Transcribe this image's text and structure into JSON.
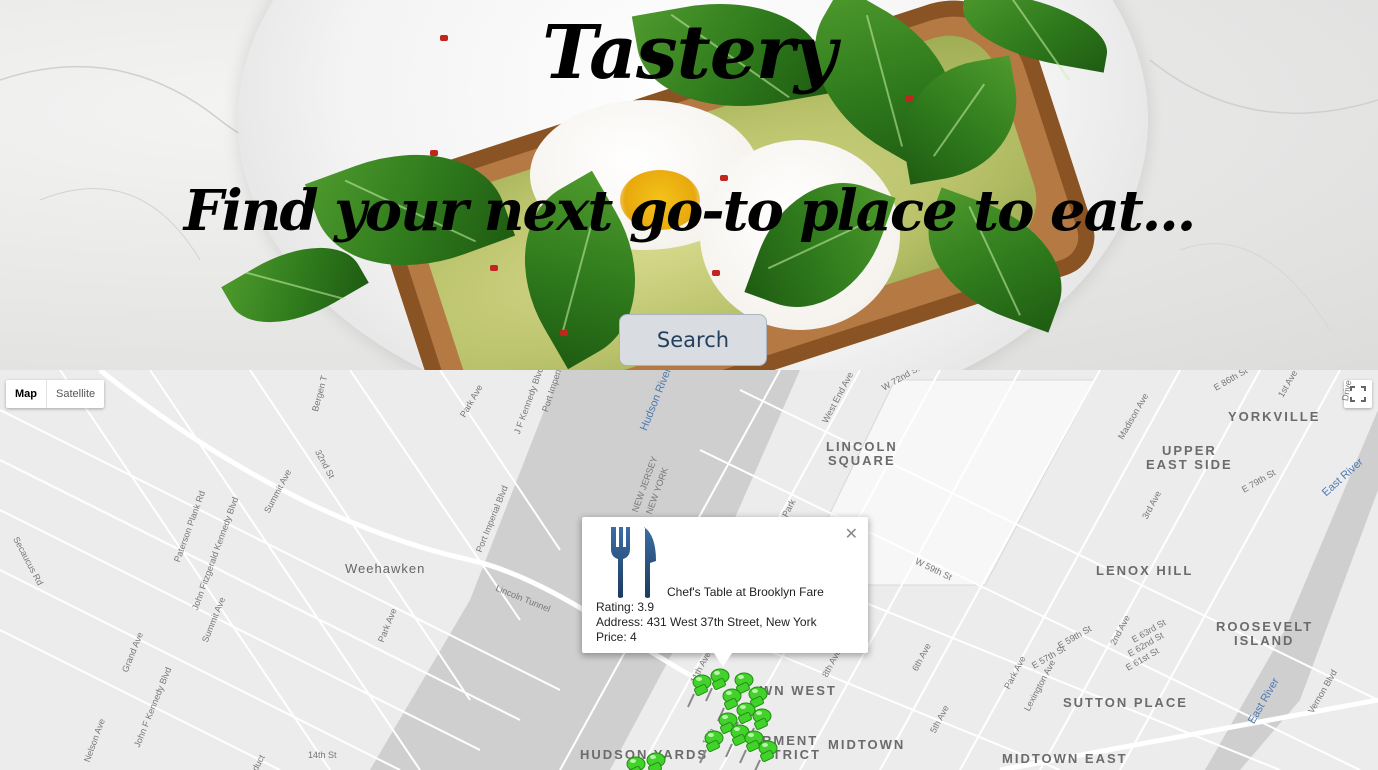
{
  "hero": {
    "title": "Tastery",
    "subtitle": "Find your next go-to place to eat...",
    "search_label": "Search"
  },
  "map": {
    "map_type": {
      "map_label": "Map",
      "satellite_label": "Satellite",
      "selected": "Map"
    },
    "areas": [
      {
        "text": "LINCOLN"
      },
      {
        "text": "SQUARE"
      },
      {
        "text": "UPPER"
      },
      {
        "text": "EAST SIDE"
      },
      {
        "text": "YORKVILLE"
      },
      {
        "text": "LENOX HILL"
      },
      {
        "text": "ROOSEVELT"
      },
      {
        "text": "ISLAND"
      },
      {
        "text": "SUTTON PLACE"
      },
      {
        "text": "MIDTOWN"
      },
      {
        "text": "MIDTOWN EAST"
      },
      {
        "text": "HUDSON YARDS"
      },
      {
        "text": "WN WEST"
      },
      {
        "text": "RMENT"
      },
      {
        "text": "STRICT"
      }
    ],
    "towns": [
      {
        "text": "Weehawken"
      }
    ],
    "water": [
      {
        "text": "Hudson River"
      },
      {
        "text": "East River"
      },
      {
        "text": "East River"
      }
    ],
    "streets": [
      "Park Ave",
      "J F Kennedy Blvd",
      "Port Imperi",
      "Bergen T",
      "32nd St",
      "Summit Ave",
      "Paterson Plank Rd",
      "John Fitzgerald Kennedy Blvd",
      "Secaucus Rd",
      "Port Imperial Blvd",
      "Lincoln Tunnel",
      "NEW JERSEY",
      "NEW YORK",
      "Grand Ave",
      "Summit Ave",
      "Park Ave",
      "Nelson Ave",
      "John F Kennedy Blvd",
      "14th St",
      "West End Ave",
      "W 72nd St",
      "Madison Ave",
      "E 86th St",
      "1st Ave",
      "E 79th St",
      "3rd Ave",
      "W 59th St",
      "E 59th St",
      "2nd Ave",
      "E 57th St",
      "E 63rd St",
      "E 62nd St",
      "E 61st St",
      "Park Ave",
      "Lexington Ave",
      "6th Ave",
      "5th Ave",
      "8th Ave",
      "11th Ave",
      "Vernon Blvd",
      "Drive",
      "Park",
      "duct",
      "10th"
    ],
    "info_window": {
      "name": "Chef's Table at Brooklyn Fare",
      "rating": "Rating: 3.9",
      "address": "Address: 431 West 37th Street, New York",
      "price": "Price: 4",
      "icon": "fork-knife-icon"
    },
    "marker_icon": "green-pushpin-icon",
    "marker_color": "#43d12c"
  }
}
